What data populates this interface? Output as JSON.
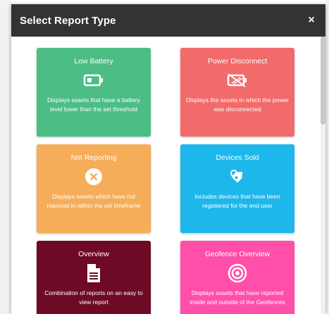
{
  "modal": {
    "title": "Select Report Type",
    "close_label": "×"
  },
  "cards": [
    {
      "title": "Low Battery",
      "description": "Displays assets that have a battery level lower than the set threshold",
      "icon": "battery-icon",
      "color": "#4dbd86"
    },
    {
      "title": "Power Disconnect",
      "description": "Displays the assets in which the power was disconnected",
      "icon": "power-disconnect-icon",
      "color": "#f26a6a"
    },
    {
      "title": "Not Reporting",
      "description": "Displays assets which have not reported in within the set timeframe",
      "icon": "close-circle-icon",
      "color": "#f5ad59"
    },
    {
      "title": "Devices Sold",
      "description": "Includes devices that have been registered for the end user",
      "icon": "tag-icon",
      "color": "#1eb7ec"
    },
    {
      "title": "Overview",
      "description": "Combination of reports on an easy to view report",
      "icon": "document-icon",
      "color": "#6e0a26"
    },
    {
      "title": "Geofence Overview",
      "description": "Displays assets that have reported inside and outside of the Geofences",
      "icon": "geofence-icon",
      "color": "#ff4fa8"
    }
  ]
}
